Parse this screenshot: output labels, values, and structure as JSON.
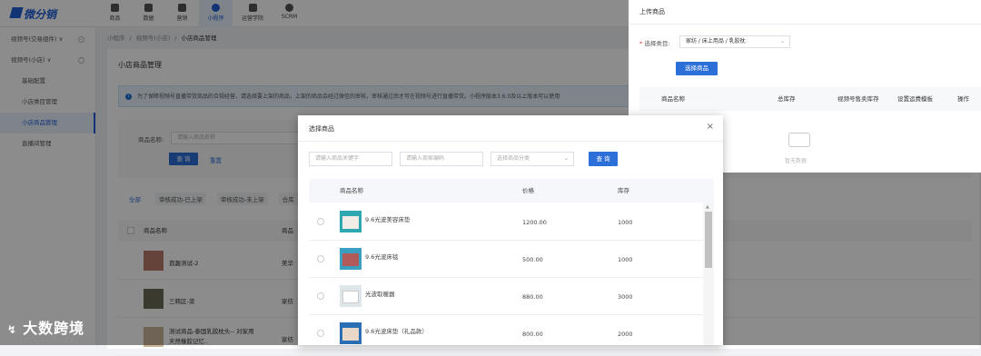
{
  "topbar": {
    "logo": "微分销",
    "nav": [
      "商品",
      "数据",
      "营销",
      "小程序",
      "运营学院",
      "SCRM"
    ],
    "active_index": 3
  },
  "sidebar": {
    "items": [
      {
        "label": "视频号(交易组件) ∨",
        "sub": false
      },
      {
        "label": "视频号(小店) ∨",
        "sub": false
      },
      {
        "label": "基础配置",
        "sub": true
      },
      {
        "label": "小店类目管理",
        "sub": true
      },
      {
        "label": "小店商品管理",
        "sub": true,
        "active": true
      },
      {
        "label": "直播间管理",
        "sub": true
      }
    ]
  },
  "breadcrumb": [
    "小程序",
    "/",
    "视频号(小店)",
    "/",
    "小店商品管理"
  ],
  "page": {
    "title": "小店商品管理",
    "notice": "为了保障视频号直播带货商品的合规经营，请选择要上架的商品，上架的商品会经过微信的审核，审核通过后才可在视频号进行直播带货。小程序版本3.6.0及以上版本可以使用",
    "search_label": "商品名称:",
    "search_placeholder": "请输入商品名称",
    "search_btn": "查 询",
    "reset_link": "重置",
    "tabs": [
      "全部",
      "审核成功-已上架",
      "审核成功-未上架",
      "仓库"
    ],
    "table_headers": [
      "商品名称",
      "商品"
    ],
    "rows": [
      {
        "name": "荔趣测试-2",
        "extra": "美华"
      },
      {
        "name": "三韩区-菜",
        "extra": "家纺"
      },
      {
        "name": "测试商品-泰国乳胶枕头-- 对家用天然橡胶记忆..",
        "extra": "家纺"
      }
    ]
  },
  "drawer": {
    "title": "上传商品",
    "cat_label": "选择类目:",
    "cat_value": "家纺 / 床上用品 / 乳胶枕",
    "upload_btn": "选择商品",
    "headers": [
      "商品名称",
      "总库存",
      "视频号售卖库存",
      "设置运费模板",
      "操作"
    ],
    "empty": "暂无数据"
  },
  "modal": {
    "title": "选择商品",
    "close": "×",
    "kw_placeholder": "请输入商品关键字",
    "code_placeholder": "请输入商家编码",
    "cat_placeholder": "选择商品分类",
    "query_btn": "查 询",
    "headers": [
      "商品名称",
      "价格",
      "库存"
    ],
    "rows": [
      {
        "name": "9.6光波美容床垫",
        "price": "1200.00",
        "stock": "1000"
      },
      {
        "name": "9.6光波床毯",
        "price": "500.00",
        "stock": "1000"
      },
      {
        "name": "光波取暖器",
        "price": "880.00",
        "stock": "3000"
      },
      {
        "name": "9.6光波床垫（礼品款）",
        "price": "800.00",
        "stock": "2000"
      }
    ]
  },
  "watermark": "大数跨境"
}
